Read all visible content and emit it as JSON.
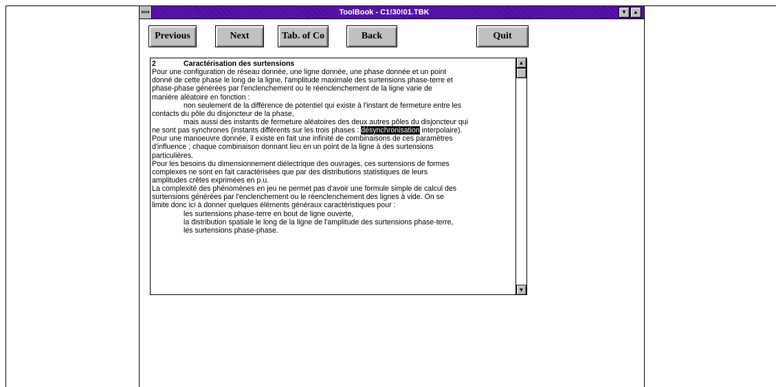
{
  "window": {
    "title": "ToolBook - C1!30!01.TBK",
    "minimize_glyph": "▼",
    "maximize_glyph": "▲"
  },
  "buttons": {
    "previous": "Previous",
    "next": "Next",
    "tab_of_contents": "Tab. of Co",
    "back": "Back",
    "quit": "Quit"
  },
  "document": {
    "heading_number": "2",
    "heading_title": "Caractérisation des surtensions",
    "lines": [
      "Pour une configuration de réseau donnée, une ligne donnée, une phase donnée et un point",
      "donné de cette phase le long de la ligne, l'amplitude maximale des surtensions phase-terre et",
      "phase-phase générées par l'enclenchement ou le réenclenchement de la ligne varie de",
      "manière aléatoire en fonction  :",
      "non seulement de la différence de potentiel qui existe à l'instant de fermeture entre les",
      "contacts du pôle du disjoncteur de la phase,",
      "mais aussi des instants de fermeture aléatoires des deux autres pôles du disjoncteur qui",
      "ne sont pas synchrones (instants différents sur les trois phases : ",
      "désynchronisation",
      " interpolaire).",
      "Pour une manoeuvre donnée, il existe en fait une infinité de combinaisons de ces paramètres",
      "d'influence ; chaque combinaison donnant lieu en un point de la ligne à des surtensions",
      "particulières.",
      "Pour les besoins du dimensionnement diélectrique des ouvrages, ces surtensions de formes",
      "complexes ne sont en fait caractérisées que par des distributions statistiques de leurs",
      "amplitudes crêtes exprimées en p.u.",
      "La complexité des phénomènes en jeu ne permet pas d'avoir une formule simple de calcul des",
      "surtensions générées par l'enclenchement ou le réenclenchement des lignes à vide. On se",
      "limite donc ici à donner quelques éléments généraux caractéristiques pour :",
      "les surtensions phase-terre en bout de ligne ouverte,",
      "la distribution spatiale le long de la ligne de l'amplitude des surtensions phase-terre,",
      "les surtensions phase-phase."
    ]
  },
  "scrollbar": {
    "up_glyph": "▲",
    "down_glyph": "▼"
  }
}
